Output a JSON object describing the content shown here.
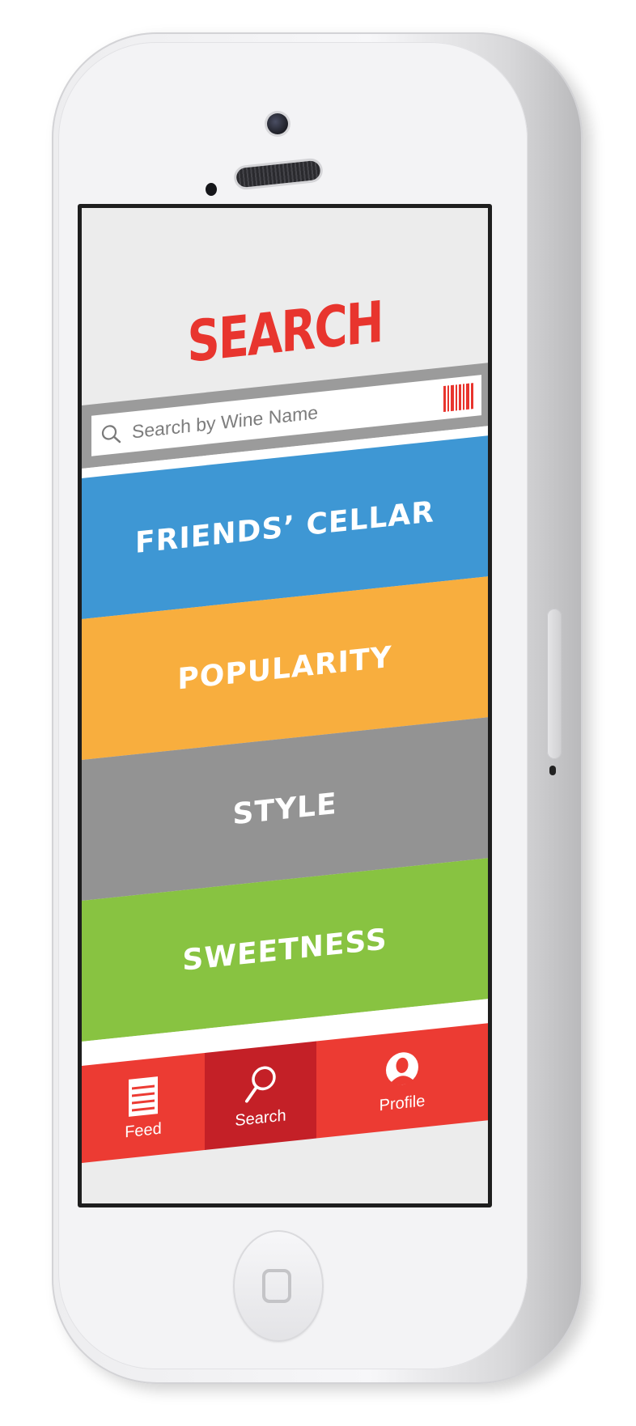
{
  "colors": {
    "accent_red": "#e8352e",
    "tab_bar_red": "#ec3b33",
    "tab_active_red": "#c42027",
    "friends_cellar_blue": "#3e97d4",
    "popularity_orange": "#f8ae3e",
    "style_gray": "#939393",
    "sweetness_green": "#88c341",
    "search_bar_gray": "#9b9b9b"
  },
  "header": {
    "title": "SEARCH"
  },
  "search": {
    "placeholder": "Search by Wine Name",
    "value": "",
    "search_icon": "magnifier-icon",
    "barcode_icon": "barcode-icon"
  },
  "categories": [
    {
      "label": "FRIENDS’ CELLAR",
      "color": "#3e97d4"
    },
    {
      "label": "POPULARITY",
      "color": "#f8ae3e"
    },
    {
      "label": "STYLE",
      "color": "#939393"
    },
    {
      "label": "SWEETNESS",
      "color": "#88c341"
    }
  ],
  "tab_bar": {
    "tabs": [
      {
        "label": "Feed",
        "icon": "list-icon",
        "active": false
      },
      {
        "label": "Search",
        "icon": "magnifier-icon",
        "active": true
      },
      {
        "label": "Profile",
        "icon": "person-icon",
        "active": false
      }
    ]
  }
}
